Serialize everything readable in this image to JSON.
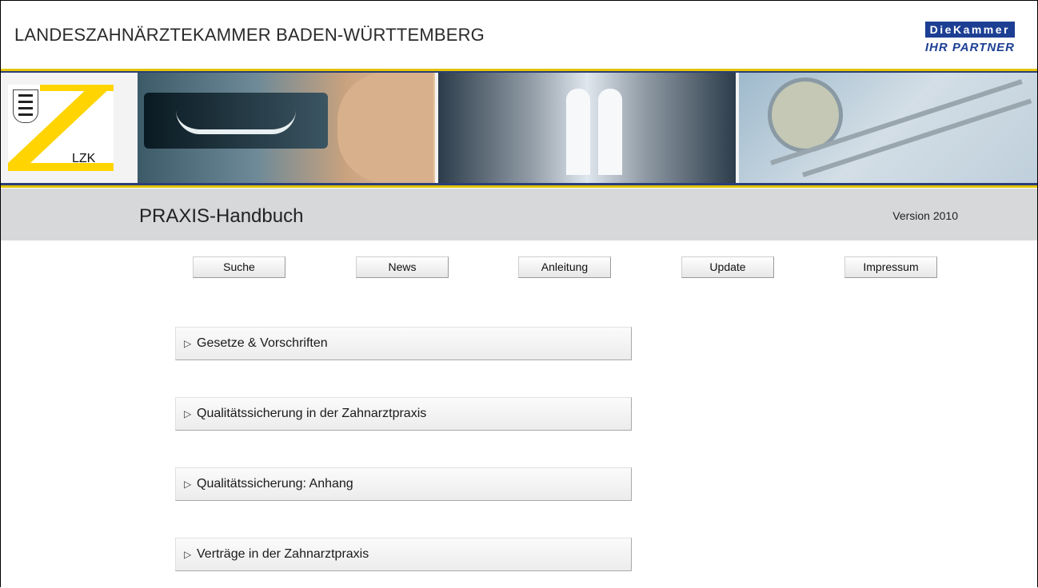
{
  "header": {
    "org_title": "LANDESZAHNÄRZTEKAMMER BADEN-WÜRTTEMBERG",
    "brand_name": "DieKammer",
    "brand_tagline": "IHR PARTNER",
    "brand_color": "#1c3f93"
  },
  "logo": {
    "text": "LZK",
    "color": "#ffd400"
  },
  "title_bar": {
    "title": "PRAXIS-Handbuch",
    "version": "Version 2010"
  },
  "nav": {
    "buttons": [
      {
        "label": "Suche"
      },
      {
        "label": "News"
      },
      {
        "label": "Anleitung"
      },
      {
        "label": "Update"
      },
      {
        "label": "Impressum"
      }
    ]
  },
  "sections": [
    {
      "icon": "triangle-right-icon",
      "label": "Gesetze & Vorschriften"
    },
    {
      "icon": "triangle-right-icon",
      "label": "Qualitätssicherung in der Zahnarztpraxis"
    },
    {
      "icon": "triangle-right-icon",
      "label": "Qualitätssicherung: Anhang"
    },
    {
      "icon": "triangle-right-icon",
      "label": "Verträge in der Zahnarztpraxis"
    }
  ]
}
